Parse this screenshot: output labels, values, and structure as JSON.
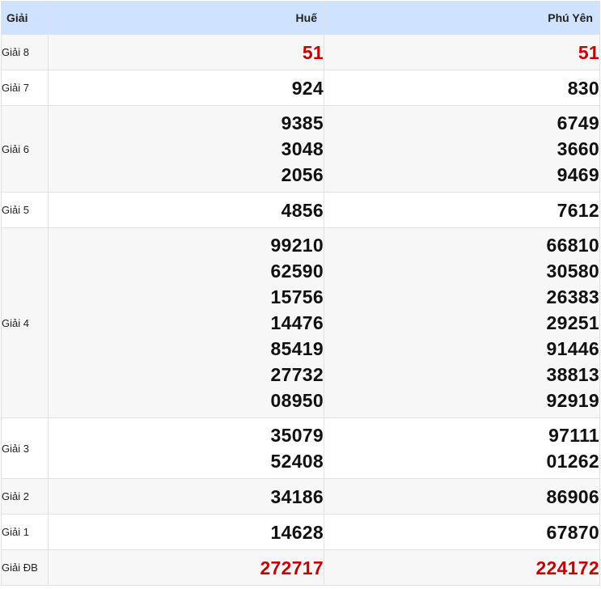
{
  "header": {
    "label": "Giải",
    "provinces": [
      "Huế",
      "Phú Yên"
    ]
  },
  "colors": {
    "header_bg": "#cfe2ff",
    "highlight": "#c00000",
    "stripe": "#f7f7f7"
  },
  "prizes": [
    {
      "label": "Giải 8",
      "hue": [
        "51"
      ],
      "phuyen": [
        "51"
      ],
      "highlight": true
    },
    {
      "label": "Giải 7",
      "hue": [
        "924"
      ],
      "phuyen": [
        "830"
      ]
    },
    {
      "label": "Giải 6",
      "hue": [
        "9385",
        "3048",
        "2056"
      ],
      "phuyen": [
        "6749",
        "3660",
        "9469"
      ]
    },
    {
      "label": "Giải 5",
      "hue": [
        "4856"
      ],
      "phuyen": [
        "7612"
      ]
    },
    {
      "label": "Giải 4",
      "hue": [
        "99210",
        "62590",
        "15756",
        "14476",
        "85419",
        "27732",
        "08950"
      ],
      "phuyen": [
        "66810",
        "30580",
        "26383",
        "29251",
        "91446",
        "38813",
        "92919"
      ]
    },
    {
      "label": "Giải 3",
      "hue": [
        "35079",
        "52408"
      ],
      "phuyen": [
        "97111",
        "01262"
      ]
    },
    {
      "label": "Giải 2",
      "hue": [
        "34186"
      ],
      "phuyen": [
        "86906"
      ]
    },
    {
      "label": "Giải 1",
      "hue": [
        "14628"
      ],
      "phuyen": [
        "67870"
      ]
    },
    {
      "label": "Giải ĐB",
      "hue": [
        "272717"
      ],
      "phuyen": [
        "224172"
      ],
      "highlight": true
    }
  ]
}
